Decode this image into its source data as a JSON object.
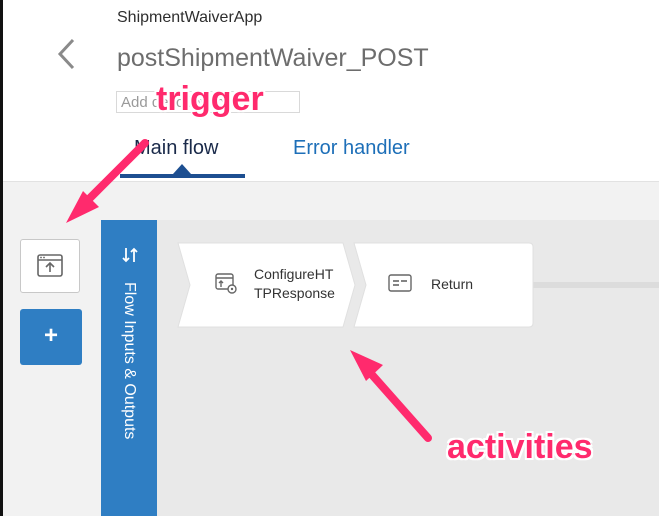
{
  "header": {
    "app_name": "ShipmentWaiverApp",
    "flow_title": "postShipmentWaiver_POST",
    "description_placeholder": "Add description"
  },
  "tabs": [
    {
      "label": "Main flow",
      "active": true
    },
    {
      "label": "Error handler",
      "active": false
    }
  ],
  "sidebar": {
    "add_label": "+"
  },
  "io_panel": {
    "label": "Flow Inputs & Outputs"
  },
  "activities": [
    {
      "label": "ConfigureHT\nTPResponse",
      "icon": "configure-http-response-icon"
    },
    {
      "label": "Return",
      "icon": "return-icon"
    }
  ],
  "annotations": {
    "trigger": "trigger",
    "activities": "activities"
  },
  "colors": {
    "accent_blue": "#2f7ec3",
    "tab_underline": "#1d4f91",
    "annotation_pink": "#ff2a6d"
  }
}
